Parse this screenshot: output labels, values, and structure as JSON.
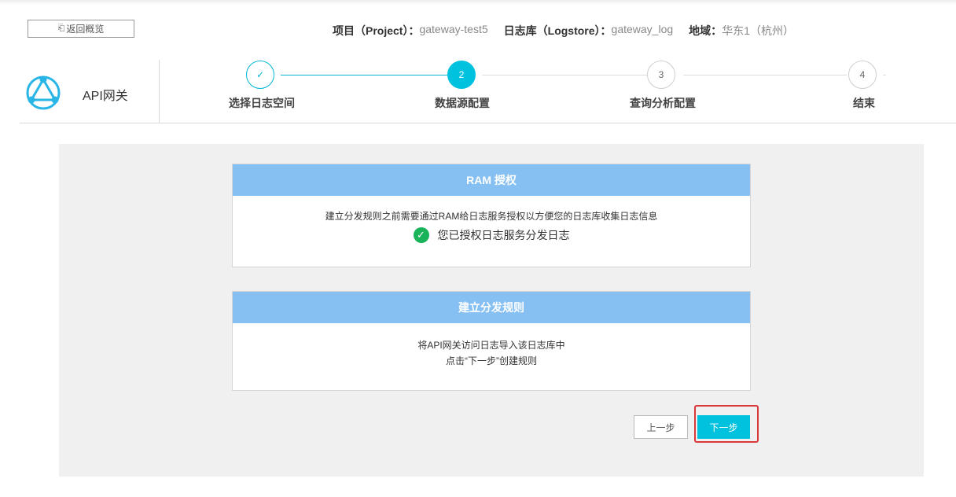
{
  "header": {
    "back_label": "返回概览",
    "meta": [
      {
        "key": "项目（Project）：",
        "value": "gateway-test5"
      },
      {
        "key": "日志库（Logstore）：",
        "value": "gateway_log"
      },
      {
        "key": "地域：",
        "value": "华东1（杭州）"
      }
    ]
  },
  "brand": {
    "name": "API网关",
    "logo_icon": "api-gateway-logo-icon"
  },
  "steps": [
    {
      "number": "✓",
      "label": "选择日志空间",
      "state": "done"
    },
    {
      "number": "2",
      "label": "数据源配置",
      "state": "active"
    },
    {
      "number": "3",
      "label": "查询分析配置",
      "state": "todo"
    },
    {
      "number": "4",
      "label": "结束",
      "state": "todo"
    }
  ],
  "ram_card": {
    "title": "RAM 授权",
    "description": "建立分发规则之前需要通过RAM给日志服务授权以方便您的日志库收集日志信息",
    "status": "您已授权日志服务分发日志",
    "status_icon": "check-circle-icon"
  },
  "rule_card": {
    "title": "建立分发规则",
    "line1": "将API网关访问日志导入该日志库中",
    "line2": "点击“下一步”创建规则"
  },
  "actions": {
    "prev_label": "上一步",
    "next_label": "下一步"
  },
  "colors": {
    "accent": "#00c1de",
    "card_header": "#86c0f2",
    "success": "#19b35a",
    "highlight": "#d9393b"
  }
}
